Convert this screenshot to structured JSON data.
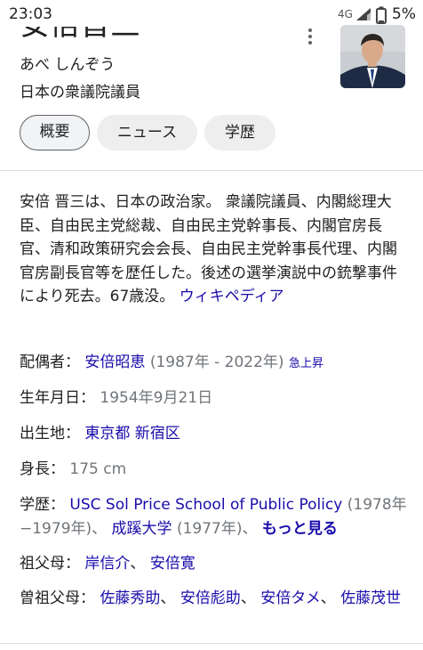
{
  "status_bar": {
    "time": "23:03",
    "network": "4G",
    "battery_percent": "5%"
  },
  "entity": {
    "name": "安倍晋三",
    "reading": "あべ しんぞう",
    "description": "日本の衆議院議員"
  },
  "tabs": [
    {
      "label": "概要",
      "active": true
    },
    {
      "label": "ニュース",
      "active": false
    },
    {
      "label": "学歴",
      "active": false
    }
  ],
  "summary": {
    "text": "安倍 晋三は、日本の政治家。 衆議院議員、内閣総理大臣、自由民主党総裁、自由民主党幹事長、内閣官房長官、清和政策研究会会長、自由民主党幹事長代理、内閣官房副長官等を歴任した。後述の選挙演説中の銃撃事件により死去。67歳没。",
    "source_link": "ウィキペディア"
  },
  "facts": {
    "spouse": {
      "label": "配偶者：",
      "name": "安倍昭恵",
      "years": "(1987年 - 2022年)",
      "trend": "急上昇"
    },
    "birth_date": {
      "label": "生年月日：",
      "value": "1954年9月21日"
    },
    "birthplace": {
      "label": "出生地：",
      "value": "東京都 新宿区"
    },
    "height": {
      "label": "身長：",
      "value": "175 cm"
    },
    "education": {
      "label": "学歴：",
      "school1": "USC Sol Price School of Public Policy",
      "school1_years": "(1978年−1979年)、",
      "school2": "成蹊大学",
      "school2_years": "(1977年)、",
      "more": "もっと見る"
    },
    "grandfathers": {
      "label": "祖父母：",
      "names": [
        "岸信介",
        "安倍寛"
      ]
    },
    "great_grandparents": {
      "label": "曽祖父母：",
      "names": [
        "佐藤秀助",
        "安倍彪助",
        "安倍タメ",
        "佐藤茂世"
      ]
    }
  },
  "colors": {
    "link": "#1a0dab",
    "text": "#202124",
    "secondary": "#70757a",
    "chip_bg": "#eeeeee"
  }
}
